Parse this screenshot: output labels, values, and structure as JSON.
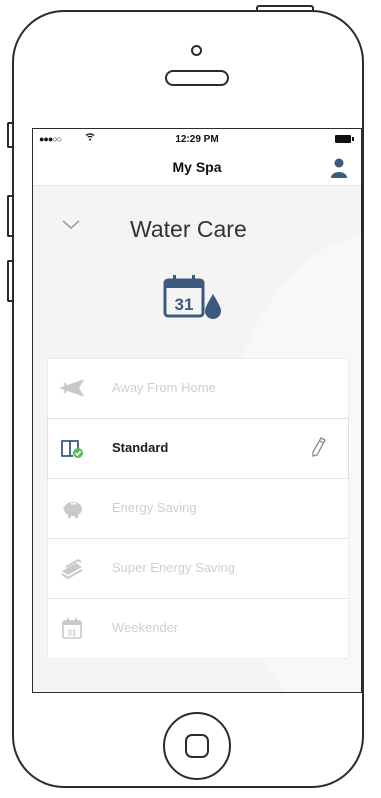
{
  "status_bar": {
    "signal": "●●●○○",
    "time": "12:29 PM"
  },
  "nav": {
    "title": "My Spa",
    "profile_icon": "person-icon"
  },
  "section": {
    "title": "Water Care",
    "toggle_icon": "chevron-down-icon",
    "hero_icon": "calendar-water-drop-icon",
    "hero_calendar_day": "31"
  },
  "modes": [
    {
      "label": "Away From Home",
      "icon": "airplane-icon",
      "selected": false
    },
    {
      "label": "Standard",
      "icon": "book-check-icon",
      "selected": true
    },
    {
      "label": "Energy Saving",
      "icon": "piggy-bank-icon",
      "selected": false
    },
    {
      "label": "Super Energy Saving",
      "icon": "money-stack-icon",
      "selected": false
    },
    {
      "label": "Weekender",
      "icon": "calendar-icon",
      "selected": false,
      "calendar_day": "31"
    }
  ],
  "colors": {
    "accent": "#3b5a7e",
    "check": "#5cb85c",
    "disabled": "#cfcfcf",
    "text": "#1a1a1a"
  }
}
